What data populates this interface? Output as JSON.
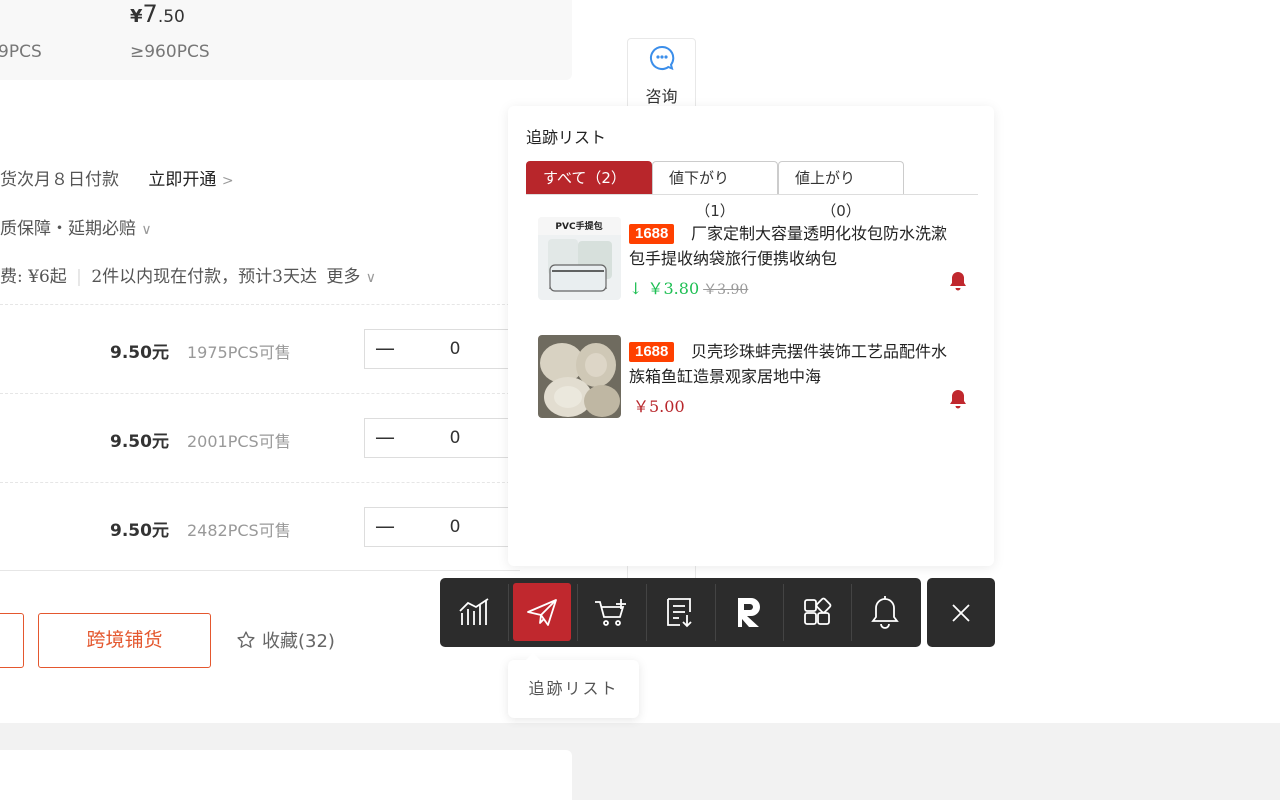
{
  "price_panel": {
    "currency": "¥",
    "price_int": "7",
    "price_dec": ".50",
    "tier_left": "9PCS",
    "tier_right": "≥960PCS"
  },
  "info": {
    "line1_text": "货次月８日付款",
    "line1_link": "立即开通",
    "line1_chevron": ">",
    "line2_text": "质保障・延期必赔",
    "line2_chevron": "∨",
    "line3_prefix": "费: ¥6起",
    "line3_text": "2件以内现在付款，预计3天达",
    "line3_more": "更多",
    "line3_chevron": "∨"
  },
  "sku_rows": [
    {
      "price": "9.50",
      "unit": "元",
      "stock": "1975PCS可售",
      "minus": "—",
      "qty": "0"
    },
    {
      "price": "9.50",
      "unit": "元",
      "stock": "2001PCS可售",
      "minus": "—",
      "qty": "0"
    },
    {
      "price": "9.50",
      "unit": "元",
      "stock": "2482PCS可售",
      "minus": "—",
      "qty": "0"
    }
  ],
  "actions": {
    "cross_border_label": "跨境铺货",
    "favorite_label": "收藏(32)"
  },
  "consult": {
    "label": "咨询"
  },
  "tracking_panel": {
    "title": "追跡リスト",
    "tabs": [
      {
        "label": "すべて（2）",
        "count": ""
      },
      {
        "label": "値下がり",
        "count": "（1）"
      },
      {
        "label": "値上がり",
        "count": "（0）"
      }
    ],
    "items": [
      {
        "badge": "1688",
        "title": "厂家定制大容量透明化妆包防水洗漱包手提收纳袋旅行便携收纳包",
        "arrow": "↓",
        "price": "￥3.80",
        "old_price": "￥3.90",
        "thumb_text": "PVC手提包"
      },
      {
        "badge": "1688",
        "title": "贝壳珍珠蚌壳摆件装饰工艺品配件水族箱鱼缸造景观家居地中海",
        "price": "￥5.00"
      }
    ]
  },
  "toolbar": {
    "icons": [
      "chart-icon",
      "send-icon",
      "cart-add-icon",
      "list-download-icon",
      "r-logo-icon",
      "apps-grid-icon",
      "bell-icon"
    ],
    "active_index": 1,
    "active_color": "#c0282e"
  },
  "tooltip": {
    "text": "追跡リスト"
  },
  "colors": {
    "accent_red": "#b8262b",
    "orange": "#e4572e",
    "badge_orange": "#ff4000",
    "price_down_green": "#1fbf54",
    "toolbar_bg": "#2c2c2c"
  }
}
